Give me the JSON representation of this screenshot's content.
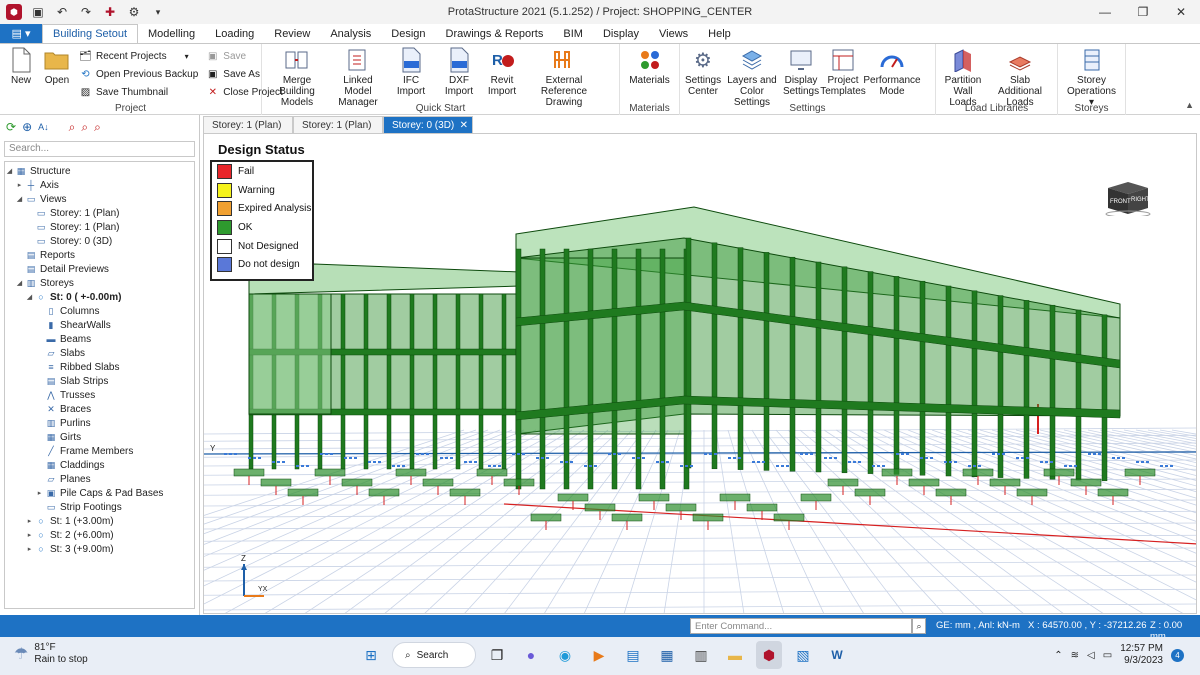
{
  "window": {
    "title": "ProtaStructure 2021 (5.1.252) / Project: SHOPPING_CENTER"
  },
  "quick_access": [
    "app-logo-icon",
    "save-icon",
    "undo-icon",
    "redo-icon",
    "settings-icon",
    "gear-icon",
    "dropdown-icon"
  ],
  "ribbon": {
    "tabs": [
      {
        "label": "Building Setout",
        "active": true
      },
      {
        "label": "Modelling"
      },
      {
        "label": "Loading"
      },
      {
        "label": "Review"
      },
      {
        "label": "Analysis"
      },
      {
        "label": "Design"
      },
      {
        "label": "Drawings & Reports"
      },
      {
        "label": "BIM"
      },
      {
        "label": "Display"
      },
      {
        "label": "Views"
      },
      {
        "label": "Help"
      }
    ],
    "project": {
      "label": "Project",
      "new": "New",
      "open": "Open",
      "recent": "Recent Projects",
      "open_backup": "Open Previous Backup",
      "save_thumbnail": "Save Thumbnail",
      "save": "Save",
      "save_as": "Save As",
      "close_project": "Close Project"
    },
    "quick_start": {
      "label": "Quick Start",
      "merge": "Merge Building Models",
      "linked": "Linked Model Manager",
      "ifc": "IFC Import",
      "dxf": "DXF Import",
      "revit": "Revit Import",
      "external": "External Reference Drawing"
    },
    "materials": {
      "label": "Materials",
      "materials": "Materials"
    },
    "settings": {
      "label": "Settings",
      "center": "Settings Center",
      "layers": "Layers and Color Settings",
      "display": "Display Settings",
      "templates": "Project Templates",
      "performance": "Performance Mode"
    },
    "load_libraries": {
      "label": "Load Libraries",
      "partition": "Partition Wall Loads",
      "slab": "Slab Additional Loads"
    },
    "storeys": {
      "label": "Storeys",
      "operations": "Storey Operations"
    }
  },
  "left_panel": {
    "search_placeholder": "Search...",
    "tree": [
      {
        "label": "Structure",
        "level": 0,
        "exp": "◢",
        "icon": "structure-icon"
      },
      {
        "label": "Axis",
        "level": 1,
        "exp": "▸",
        "icon": "axis-icon"
      },
      {
        "label": "Views",
        "level": 1,
        "exp": "◢",
        "icon": "views-icon"
      },
      {
        "label": "Storey: 1 (Plan)",
        "level": 2,
        "exp": "",
        "icon": "plan-view-icon"
      },
      {
        "label": "Storey: 1 (Plan)",
        "level": 2,
        "exp": "",
        "icon": "plan-view-icon"
      },
      {
        "label": "Storey: 0 (3D)",
        "level": 2,
        "exp": "",
        "icon": "3d-view-icon"
      },
      {
        "label": "Reports",
        "level": 1,
        "exp": "",
        "icon": "reports-icon"
      },
      {
        "label": "Detail Previews",
        "level": 1,
        "exp": "",
        "icon": "detail-previews-icon"
      },
      {
        "label": "Storeys",
        "level": 1,
        "exp": "◢",
        "icon": "storeys-icon"
      },
      {
        "label": "St: 0 ( +-0.00m)",
        "level": 2,
        "exp": "◢",
        "icon": "storey-dot-icon",
        "bold": true
      },
      {
        "label": "Columns",
        "level": 3,
        "exp": "",
        "icon": "columns-icon"
      },
      {
        "label": "ShearWalls",
        "level": 3,
        "exp": "",
        "icon": "shearwalls-icon"
      },
      {
        "label": "Beams",
        "level": 3,
        "exp": "",
        "icon": "beams-icon"
      },
      {
        "label": "Slabs",
        "level": 3,
        "exp": "",
        "icon": "slabs-icon"
      },
      {
        "label": "Ribbed Slabs",
        "level": 3,
        "exp": "",
        "icon": "ribbed-slabs-icon"
      },
      {
        "label": "Slab Strips",
        "level": 3,
        "exp": "",
        "icon": "slab-strips-icon"
      },
      {
        "label": "Trusses",
        "level": 3,
        "exp": "",
        "icon": "trusses-icon"
      },
      {
        "label": "Braces",
        "level": 3,
        "exp": "",
        "icon": "braces-icon"
      },
      {
        "label": "Purlins",
        "level": 3,
        "exp": "",
        "icon": "purlins-icon"
      },
      {
        "label": "Girts",
        "level": 3,
        "exp": "",
        "icon": "girts-icon"
      },
      {
        "label": "Frame Members",
        "level": 3,
        "exp": "",
        "icon": "frame-members-icon"
      },
      {
        "label": "Claddings",
        "level": 3,
        "exp": "",
        "icon": "claddings-icon"
      },
      {
        "label": "Planes",
        "level": 3,
        "exp": "",
        "icon": "planes-icon"
      },
      {
        "label": "Pile Caps & Pad Bases",
        "level": 3,
        "exp": "▸",
        "icon": "pile-caps-icon"
      },
      {
        "label": "Strip Footings",
        "level": 3,
        "exp": "",
        "icon": "strip-footings-icon"
      },
      {
        "label": "St: 1 (+3.00m)",
        "level": 2,
        "exp": "▸",
        "icon": "storey-dot-icon"
      },
      {
        "label": "St: 2 (+6.00m)",
        "level": 2,
        "exp": "▸",
        "icon": "storey-dot-icon"
      },
      {
        "label": "St: 3 (+9.00m)",
        "level": 2,
        "exp": "▸",
        "icon": "storey-dot-icon"
      }
    ]
  },
  "viewport": {
    "tabs": [
      {
        "label": "Storey: 1 (Plan)"
      },
      {
        "label": "Storey: 1 (Plan)"
      },
      {
        "label": "Storey: 0 (3D)",
        "active": true
      }
    ],
    "legend": {
      "title": "Design Status",
      "items": [
        {
          "label": "Fail",
          "color": "#e8252a"
        },
        {
          "label": "Warning",
          "color": "#f5f21a"
        },
        {
          "label": "Expired Analysis",
          "color": "#f0a030"
        },
        {
          "label": "OK",
          "color": "#2e9a2e"
        },
        {
          "label": "Not Designed",
          "color": "#ffffff"
        },
        {
          "label": "Do not design",
          "color": "#5a78d8"
        }
      ]
    },
    "navcube": {
      "front": "FRONT",
      "right": "RIGHT"
    },
    "axes": {
      "y": "Y",
      "z": "Z",
      "yx": "YX"
    }
  },
  "statusbar": {
    "command_placeholder": "Enter Command...",
    "units": "GE: mm , Anl: kN-m",
    "coords": "X : 64570.00 , Y : -37212.26",
    "z": "Z : 0.00 mm"
  },
  "taskbar": {
    "weather_temp": "81°F",
    "weather_desc": "Rain to stop",
    "search": "Search",
    "time": "12:57 PM",
    "date": "9/3/2023",
    "notifications": "4"
  },
  "colors": {
    "accent": "#1e72c4",
    "structure_green": "#1f7a1f",
    "fail_red": "#e8252a"
  }
}
